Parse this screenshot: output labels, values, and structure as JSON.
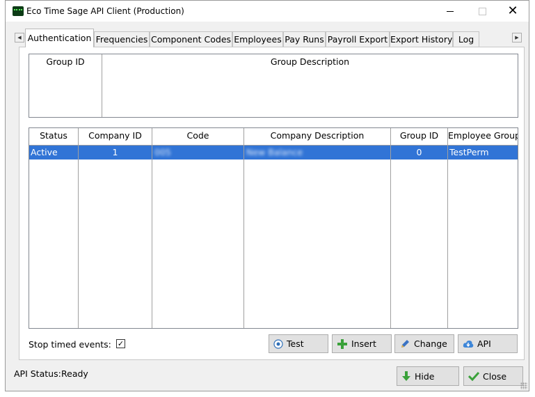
{
  "window": {
    "title": "Eco Time Sage API Client (Production)",
    "close_glyph": "✕"
  },
  "tabs": [
    {
      "label": "Authentication",
      "active": true
    },
    {
      "label": "Frequencies"
    },
    {
      "label": "Component Codes"
    },
    {
      "label": "Employees"
    },
    {
      "label": "Pay Runs"
    },
    {
      "label": "Payroll Export"
    },
    {
      "label": "Export History"
    },
    {
      "label": "Log"
    }
  ],
  "groups_table": {
    "columns": [
      "Group ID",
      "Group Description"
    ],
    "rows": []
  },
  "companies_table": {
    "columns": [
      "Status",
      "Company ID",
      "Code",
      "Company Description",
      "Group ID",
      "Employee Group"
    ],
    "rows": [
      {
        "status": "Active",
        "company_id": "1",
        "code": "005",
        "company_description": "New Balance",
        "group_id": "0",
        "employee_group": "TestPerm",
        "selected": true
      }
    ]
  },
  "options": {
    "stop_timed_events_label": "Stop timed events:",
    "stop_timed_events_checked": true,
    "check_glyph": "✓"
  },
  "buttons": {
    "test": "Test",
    "insert": "Insert",
    "change": "Change",
    "api": "API",
    "hide": "Hide",
    "close": "Close"
  },
  "status": {
    "label": "API Status:",
    "value": "Ready"
  },
  "colors": {
    "selection": "#3174d6",
    "app_icon": "#0d3b16"
  }
}
